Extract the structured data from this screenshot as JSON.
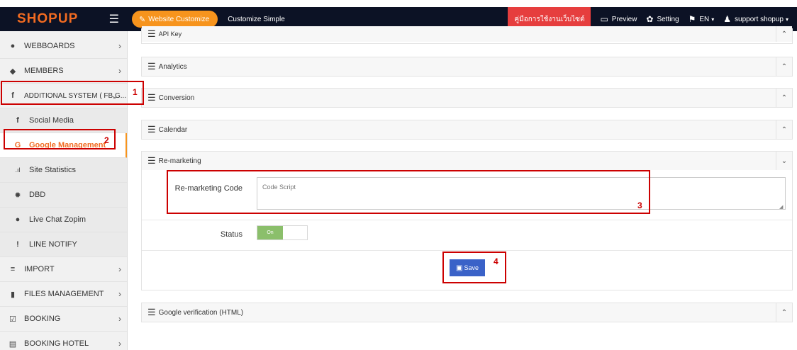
{
  "topbar": {
    "logo": "SHOPUP",
    "website_customize": "Website Customize",
    "customize_simple": "Customize Simple",
    "manual": "คู่มือการใช้งานเว็บไซต์",
    "preview": "Preview",
    "setting": "Setting",
    "language": "EN",
    "user": "support shopup"
  },
  "sidebar": {
    "items": [
      {
        "label": "WEBBOARDS",
        "icon": "chat-bubbles-icon",
        "chevron": "›"
      },
      {
        "label": "MEMBERS",
        "icon": "users-icon",
        "chevron": "›"
      },
      {
        "label": "ADDITIONAL SYSTEM ( FB,G...",
        "icon": "facebook-icon",
        "chevron": "⌄"
      },
      {
        "label": "Social Media",
        "icon": "facebook-icon"
      },
      {
        "label": "Google Management",
        "icon": "google-icon"
      },
      {
        "label": "Site Statistics",
        "icon": "signal-bars-icon"
      },
      {
        "label": "DBD",
        "icon": "starburst-icon"
      },
      {
        "label": "Live Chat Zopim",
        "icon": "chat-bubbles-icon"
      },
      {
        "label": "LINE NOTIFY",
        "icon": "exclamation-icon"
      },
      {
        "label": "IMPORT",
        "icon": "list-icon",
        "chevron": "›"
      },
      {
        "label": "FILES MANAGEMENT",
        "icon": "file-icon",
        "chevron": "›"
      },
      {
        "label": "BOOKING",
        "icon": "checkbox-icon",
        "chevron": "›"
      },
      {
        "label": "BOOKING HOTEL",
        "icon": "calendar-icon",
        "chevron": "›"
      }
    ]
  },
  "annotations": [
    "1",
    "2",
    "3",
    "4"
  ],
  "panels": {
    "api_key": "API Key",
    "analytics": "Analytics",
    "conversion": "Conversion",
    "calendar": "Calendar",
    "remarketing": "Re-marketing",
    "google_verification": "Google verification (HTML)"
  },
  "remarketing_form": {
    "code_label": "Re-marketing Code",
    "code_placeholder": "Code Script",
    "status_label": "Status",
    "toggle_on": "On",
    "save_label": "Save"
  },
  "colors": {
    "topbar_bg": "#0c1225",
    "brand_orange": "#f26b21",
    "manual_red": "#e63e3e",
    "save_blue": "#3a62c8",
    "toggle_green": "#8bbf6b",
    "annotation_red": "#cc0000"
  }
}
